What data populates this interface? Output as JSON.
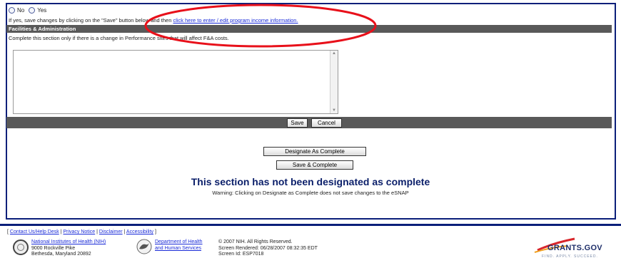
{
  "program_income": {
    "radio_no_label": "No",
    "radio_yes_label": "Yes",
    "instruction_prefix": "If yes, save changes by clicking on the \"Save\" button below and then ",
    "instruction_link": "click here to enter / edit program income information."
  },
  "facilities": {
    "header": "Facilities & Administration",
    "instruction": "Complete this section only if there is a change in Performance sites that will affect F&A costs.",
    "textarea_value": ""
  },
  "form_buttons": {
    "save": "Save",
    "cancel": "Cancel",
    "designate_complete": "Designate As Complete",
    "save_complete": "Save & Complete"
  },
  "status": {
    "title": "This section has not been designated as complete",
    "warning": "Warning: Clicking on Designate as Complete does not save changes to the eSNAP"
  },
  "footer": {
    "links": [
      "Contact Us/Help Desk",
      "Privacy Notice",
      "Disclaimer",
      "Accessibility"
    ],
    "nih_name": "National Institutes of Health (NIH)",
    "nih_address1": "9000 Rockville Pike",
    "nih_address2": "Bethesda, Maryland 20892",
    "hhs_line1": "Department of Health",
    "hhs_line2": "and Human Services",
    "copyright": "© 2007 NIH. All Rights Reserved.",
    "rendered": "Screen Rendered: 06/28/2007 08:32:35 EDT",
    "screen_id": "Screen Id: ESP7018",
    "grants_logo_text": "GRANTS.GOV",
    "grants_tagline": "FIND. APPLY. SUCCEED."
  },
  "colors": {
    "panel_border": "#0b1f7a",
    "section_bar": "#595959",
    "link": "#1a2bd8",
    "highlight_ellipse": "#e8101a"
  }
}
